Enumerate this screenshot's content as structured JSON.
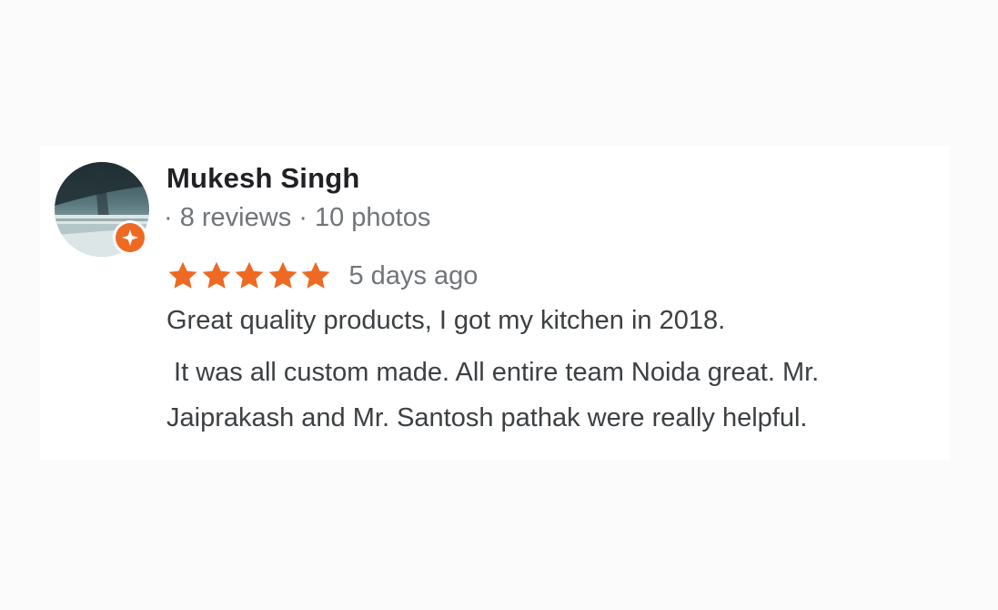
{
  "review": {
    "reviewer_name": "Mukesh Singh",
    "reviewer_meta": "· 8 reviews · 10 photos",
    "rating": 5,
    "rating_max": 5,
    "date": "5 days ago",
    "text_lines": [
      "Great quality products, I got my kitchen in 2018.",
      " It was all custom made. All entire team Noida great. Mr.",
      "Jaiprakash and Mr. Santosh pathak were really helpful."
    ]
  },
  "colors": {
    "star": "#ee6a22",
    "badge": "#ee6a22",
    "name": "#202124",
    "meta": "#70757a",
    "body_text": "#3c4043"
  },
  "icons": {
    "avatar": "reviewer-avatar-photo",
    "badge": "local-guide-badge-icon",
    "star": "star-icon"
  }
}
